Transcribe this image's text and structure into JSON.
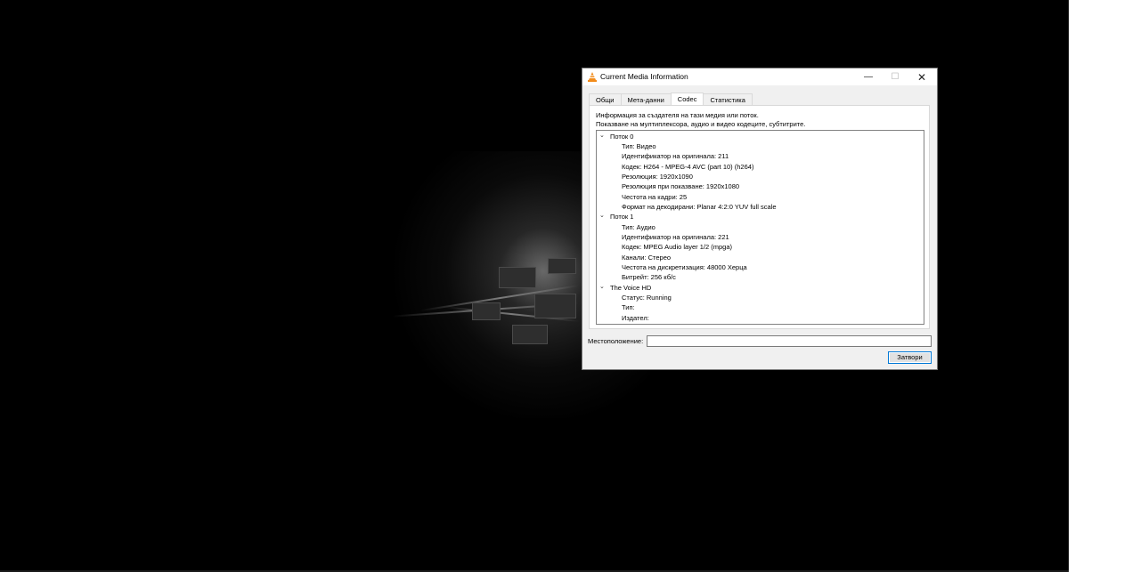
{
  "window": {
    "title": "Current Media Information",
    "minimize_glyph": "—",
    "maximize_glyph": "☐",
    "close_glyph": "✕"
  },
  "tabs": [
    {
      "label": "Общи",
      "active": false
    },
    {
      "label": "Мета-данни",
      "active": false
    },
    {
      "label": "Codec",
      "active": true
    },
    {
      "label": "Статистика",
      "active": false
    }
  ],
  "codec": {
    "info_line1": "Информация за създателя на тази медия или поток.",
    "info_line2": "Показване на мултиплексора, аудио и видео кодеците, субтитрите.",
    "streams": [
      {
        "name": "Поток 0",
        "items": [
          "Тип: Видео",
          "Идентификатор на оригинала: 211",
          "Кодек: H264 - MPEG-4 AVC (part 10) (h264)",
          "Резолюция: 1920x1090",
          "Резолюция при показване: 1920x1080",
          "Честота на кадри: 25",
          "Формат на декодирани: Planar 4:2:0 YUV full scale"
        ]
      },
      {
        "name": "Поток 1",
        "items": [
          "Тип: Аудио",
          "Идентификатор на оригинала: 221",
          "Кодек: MPEG Audio layer 1/2 (mpga)",
          "Канали: Стерео",
          "Честота на дискретизация: 48000 Херца",
          "Битрейт: 256 кб/с"
        ]
      },
      {
        "name": "The Voice HD",
        "items": [
          "Статус: Running",
          "Тип:",
          "Издател:"
        ]
      }
    ]
  },
  "location": {
    "label": "Местоположение:",
    "value": ""
  },
  "buttons": {
    "close_label": "Затвори"
  },
  "icons": {
    "app": "vlc-cone-icon",
    "expand": "chevron-down-icon"
  },
  "colors": {
    "video_bg": "#000000",
    "dialog_bg": "#f0f0f0",
    "accent": "#0078d7"
  }
}
